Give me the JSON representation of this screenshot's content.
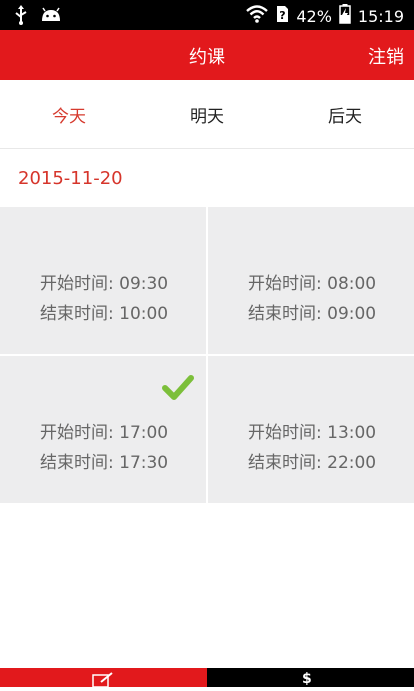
{
  "status_bar": {
    "battery": "42%",
    "time": "15:19"
  },
  "app_bar": {
    "title": "约课",
    "logout_label": "注销"
  },
  "tabs": [
    {
      "label": "今天",
      "active": true
    },
    {
      "label": "明天",
      "active": false
    },
    {
      "label": "后天",
      "active": false
    }
  ],
  "selected_date": "2015-11-20",
  "slots": [
    {
      "start": "开始时间: 09:30",
      "end": "结束时间: 10:00",
      "selected": false
    },
    {
      "start": "开始时间: 08:00",
      "end": "结束时间: 09:00",
      "selected": false
    },
    {
      "start": "开始时间: 17:00",
      "end": "结束时间: 17:30",
      "selected": true
    },
    {
      "start": "开始时间: 13:00",
      "end": "结束时间: 22:00",
      "selected": false
    }
  ],
  "bottom_nav": [
    {
      "icon": "edit-icon"
    },
    {
      "icon": "dollar-icon"
    }
  ],
  "colors": {
    "primary": "#e2191c",
    "accent_text": "#d6352b",
    "grid_bg": "#ededee",
    "check": "#7cbf3a"
  }
}
